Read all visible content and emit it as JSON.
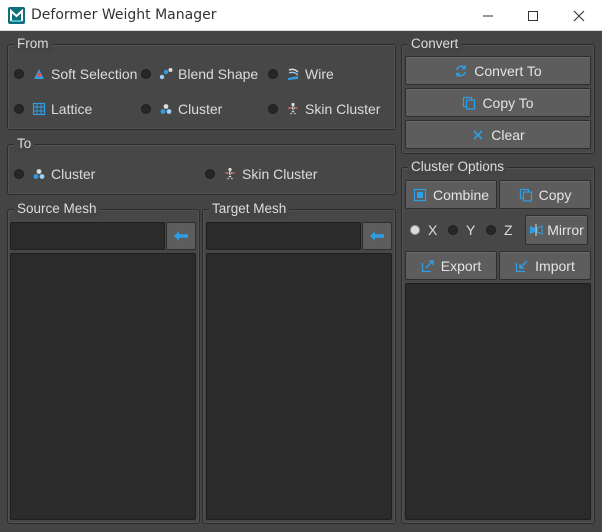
{
  "window": {
    "title": "Deformer Weight Manager"
  },
  "from": {
    "title": "From",
    "options": [
      {
        "label": "Soft Selection",
        "icon": "soft-selection-icon",
        "selected": false
      },
      {
        "label": "Blend Shape",
        "icon": "blend-shape-icon",
        "selected": false
      },
      {
        "label": "Wire",
        "icon": "wire-icon",
        "selected": false
      },
      {
        "label": "Lattice",
        "icon": "lattice-icon",
        "selected": false
      },
      {
        "label": "Cluster",
        "icon": "cluster-icon",
        "selected": false
      },
      {
        "label": "Skin Cluster",
        "icon": "skin-cluster-icon",
        "selected": false
      }
    ]
  },
  "to": {
    "title": "To",
    "options": [
      {
        "label": "Cluster",
        "icon": "cluster-icon",
        "selected": false
      },
      {
        "label": "Skin Cluster",
        "icon": "skin-cluster-icon",
        "selected": false
      }
    ]
  },
  "source_mesh": {
    "title": "Source Mesh",
    "value": ""
  },
  "target_mesh": {
    "title": "Target Mesh",
    "value": ""
  },
  "convert": {
    "title": "Convert",
    "buttons": {
      "convert_to": "Convert To",
      "copy_to": "Copy To",
      "clear": "Clear"
    }
  },
  "cluster_options": {
    "title": "Cluster Options",
    "combine": "Combine",
    "copy": "Copy",
    "axes": [
      {
        "label": "X",
        "selected": true
      },
      {
        "label": "Y",
        "selected": false
      },
      {
        "label": "Z",
        "selected": false
      }
    ],
    "mirror": "Mirror",
    "export": "Export",
    "import": "Import"
  },
  "colors": {
    "accent": "#2e9fe6",
    "panel": "#444444",
    "field": "#2b2b2b",
    "button": "#5d5d5d"
  }
}
